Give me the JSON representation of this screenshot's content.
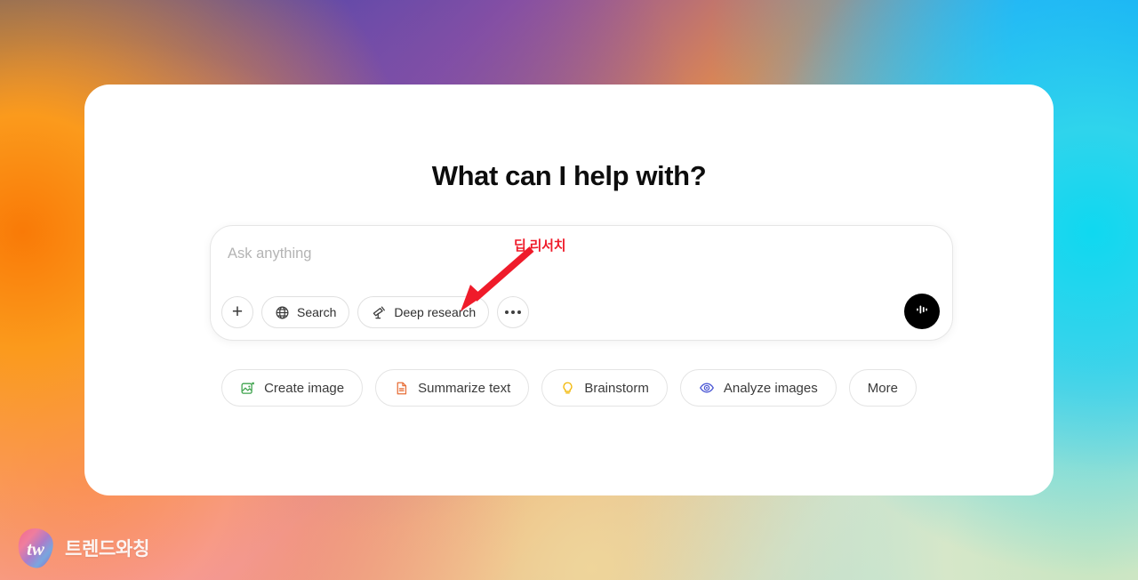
{
  "page": {
    "headline": "What can I help with?"
  },
  "composer": {
    "placeholder": "Ask anything",
    "add_label": "",
    "more_label": "",
    "tools": [
      {
        "label": "Search",
        "icon": "globe-icon"
      },
      {
        "label": "Deep research",
        "icon": "telescope-icon"
      }
    ],
    "voice_label": ""
  },
  "suggestions": [
    {
      "label": "Create image",
      "icon": "image-icon",
      "color": "#3fa34d"
    },
    {
      "label": "Summarize text",
      "icon": "document-icon",
      "color": "#e8703a"
    },
    {
      "label": "Brainstorm",
      "icon": "lightbulb-icon",
      "color": "#f2b705"
    },
    {
      "label": "Analyze images",
      "icon": "eye-icon",
      "color": "#4f5bd5"
    },
    {
      "label": "More",
      "icon": "",
      "color": ""
    }
  ],
  "annotation": {
    "label": "딥 리서치",
    "color": "#ef1b2a"
  },
  "watermark": {
    "logo_text": "tw",
    "brand_text": "트렌드와칭"
  },
  "colors": {
    "accent_black": "#000000",
    "annotation_red": "#ef1b2a",
    "card_background": "#ffffff"
  }
}
